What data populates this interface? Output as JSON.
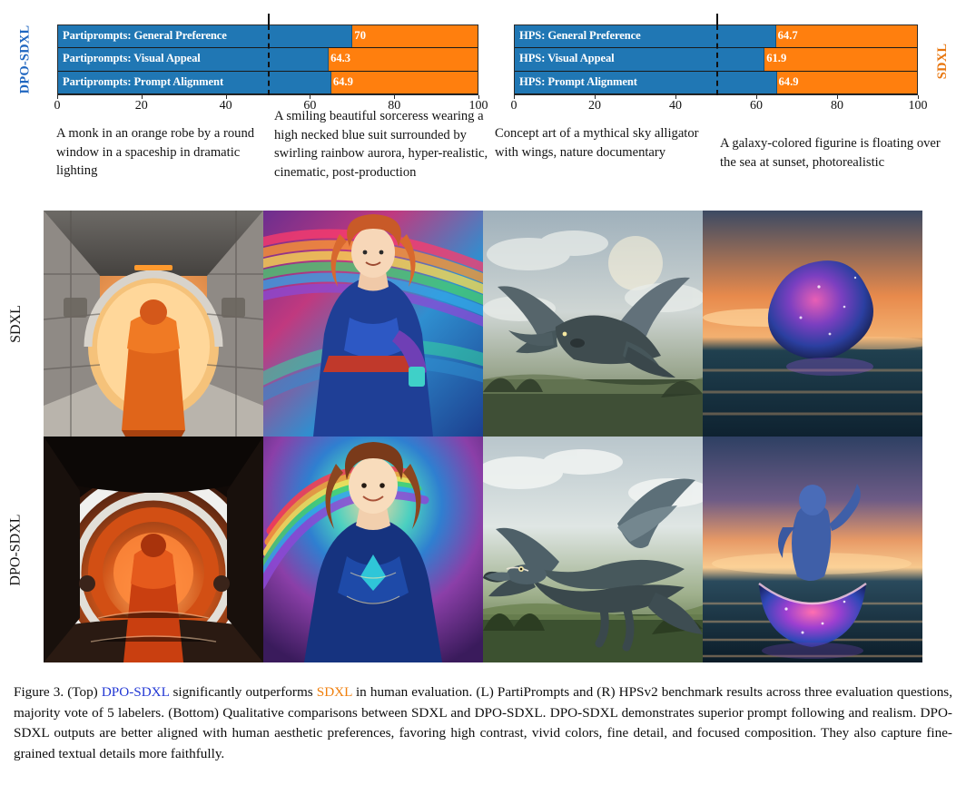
{
  "charts": {
    "left": {
      "side_label": "DPO-SDXL",
      "side_label_color": "#1f66c0",
      "axis_ticks": [
        "0",
        "20",
        "40",
        "60",
        "80",
        "100"
      ],
      "tick_values": [
        0,
        20,
        40,
        60,
        80,
        100
      ]
    },
    "right": {
      "side_label": "SDXL",
      "side_label_color": "#e8760e",
      "axis_ticks": [
        "0",
        "20",
        "40",
        "60",
        "80",
        "100"
      ],
      "tick_values": [
        0,
        20,
        40,
        60,
        80,
        100
      ]
    }
  },
  "chart_data": [
    {
      "type": "bar",
      "orientation": "horizontal",
      "stacked": true,
      "title": "",
      "xlabel": "",
      "ylabel": "",
      "xlim": [
        0,
        100
      ],
      "grid": false,
      "reference_line": 50,
      "categories": [
        "Partiprompts: General Preference",
        "Partiprompts: Visual Appeal",
        "Partiprompts: Prompt Alignment"
      ],
      "series": [
        {
          "name": "DPO-SDXL",
          "color": "#2077b4",
          "values": [
            70,
            64.3,
            64.9
          ]
        },
        {
          "name": "SDXL",
          "color": "#ff7f0e",
          "values": [
            30,
            35.7,
            35.1
          ]
        }
      ],
      "value_labels": [
        "70",
        "64.3",
        "64.9"
      ]
    },
    {
      "type": "bar",
      "orientation": "horizontal",
      "stacked": true,
      "title": "",
      "xlabel": "",
      "ylabel": "",
      "xlim": [
        0,
        100
      ],
      "grid": false,
      "reference_line": 50,
      "categories": [
        "HPS: General Preference",
        "HPS: Visual Appeal",
        "HPS: Prompt Alignment"
      ],
      "series": [
        {
          "name": "DPO-SDXL",
          "color": "#2077b4",
          "values": [
            64.7,
            61.9,
            64.9
          ]
        },
        {
          "name": "SDXL",
          "color": "#ff7f0e",
          "values": [
            35.3,
            38.1,
            35.1
          ]
        }
      ],
      "value_labels": [
        "64.7",
        "61.9",
        "64.9"
      ]
    }
  ],
  "prompts": [
    "A monk in an orange robe by a round window in a spaceship in dramatic lighting",
    "A smiling beautiful sorceress wearing a high necked blue suit surrounded by swirling rainbow aurora, hyper-realistic, cinematic, post-production",
    "Concept art of a mythical sky alligator with wings, nature documentary",
    "A galaxy-colored figurine is floating over the sea at sunset, photorealistic"
  ],
  "grid": {
    "row_labels": [
      "SDXL",
      "DPO-SDXL"
    ]
  },
  "caption": {
    "prefix": "Figure 3. (Top) ",
    "model_a": "DPO-SDXL",
    "mid1": " significantly outperforms ",
    "model_b": "SDXL",
    "rest": " in human evaluation. (L) PartiPrompts and (R) HPSv2 benchmark results across three evaluation questions, majority vote of 5 labelers. (Bottom) Qualitative comparisons between SDXL and DPO-SDXL. DPO-SDXL demonstrates superior prompt following and realism. DPO-SDXL outputs are better aligned with human aesthetic preferences, favoring high contrast, vivid colors, fine detail, and focused composition. They also capture fine-grained textual details more faithfully."
  }
}
